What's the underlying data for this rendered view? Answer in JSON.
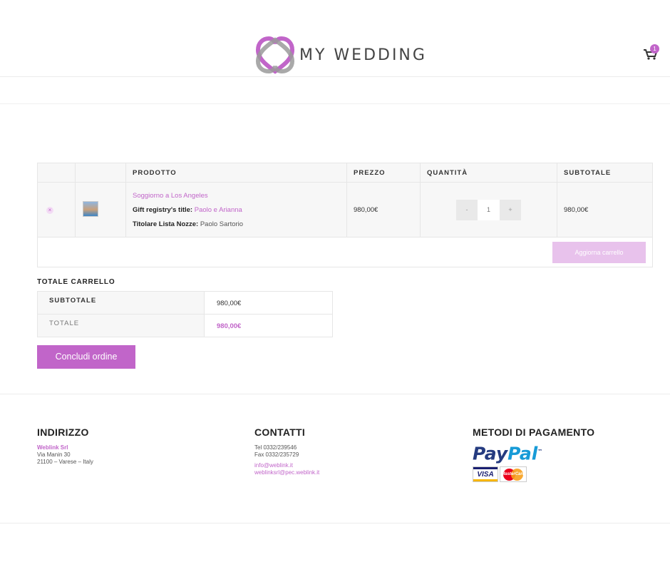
{
  "header": {
    "logo_text": "MY WEDDING",
    "cart_count": "1"
  },
  "cart_table": {
    "headers": [
      "PRODOTTO",
      "PREZZO",
      "QUANTITÀ",
      "SUBTOTALE"
    ],
    "items": [
      {
        "remove_glyph": "×",
        "name": "Soggiorno a Los Angeles",
        "meta": [
          {
            "label": "Gift registry's title:",
            "value": "Paolo e Arianna"
          },
          {
            "label": "Titolare Lista Nozze:",
            "value": "Paolo Sartorio"
          }
        ],
        "price": "980,00€",
        "qty_minus": "-",
        "qty": "1",
        "qty_plus": "+",
        "subtotal": "980,00€"
      }
    ],
    "update_label": "Aggiorna carrello"
  },
  "totals": {
    "title": "TOTALE CARRELLO",
    "subtotal_label": "SUBTOTALE",
    "subtotal_value": "980,00€",
    "total_label": "TOTALE",
    "total_value": "980,00€"
  },
  "checkout_label": "Concludi ordine",
  "footer": {
    "address": {
      "title": "INDIRIZZO",
      "company": "Weblink Srl",
      "street": "Via Manin 30",
      "city": "21100 – Varese – Italy"
    },
    "contacts": {
      "title": "CONTATTI",
      "tel": "Tel 0332/239546",
      "fax": "Fax 0332/235729",
      "email": "info@weblink.it",
      "pec": "weblinksrl@pec.weblink.it"
    },
    "payments": {
      "title": "METODI DI PAGAMENTO",
      "paypal_pay": "Pay",
      "paypal_pal": "Pal",
      "paypal_tm": "™",
      "visa": "VISA",
      "mastercard": "MasterCard"
    }
  },
  "colors": {
    "accent": "#c165c9",
    "accent_light": "#e8c2ec",
    "border": "#e6e6e6",
    "cell_bg": "#f7f7f7"
  }
}
